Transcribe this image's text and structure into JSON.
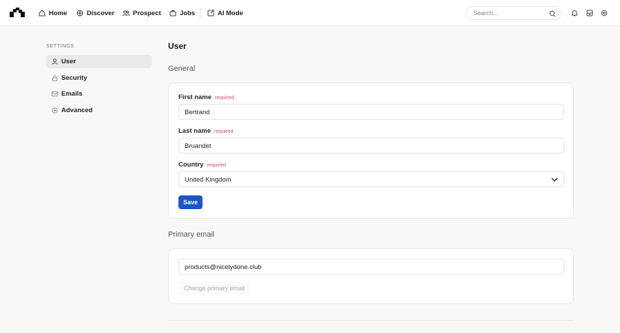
{
  "header": {
    "nav": [
      {
        "label": "Home",
        "icon": "home-icon"
      },
      {
        "label": "Discover",
        "icon": "globe-icon"
      },
      {
        "label": "Prospect",
        "icon": "users-icon"
      },
      {
        "label": "Jobs",
        "icon": "briefcase-icon"
      },
      {
        "label": "AI Mode",
        "icon": "ai-mode-icon"
      }
    ],
    "search_placeholder": "Search..."
  },
  "sidebar": {
    "heading": "SETTINGS",
    "items": [
      {
        "label": "User"
      },
      {
        "label": "Security"
      },
      {
        "label": "Emails"
      },
      {
        "label": "Advanced"
      }
    ]
  },
  "main": {
    "title": "User",
    "general": {
      "heading": "General",
      "first_name_label": "First name",
      "first_name": "Bertrand",
      "last_name_label": "Last name",
      "last_name": "Bruandet",
      "country_label": "Country",
      "country": "United Kingdom",
      "required": "required",
      "save": "Save"
    },
    "email": {
      "heading": "Primary email",
      "value": "products@nicelydone.club",
      "change": "Change primary email"
    }
  },
  "colors": {
    "accent": "#1d56c8",
    "required": "#e0455b"
  }
}
